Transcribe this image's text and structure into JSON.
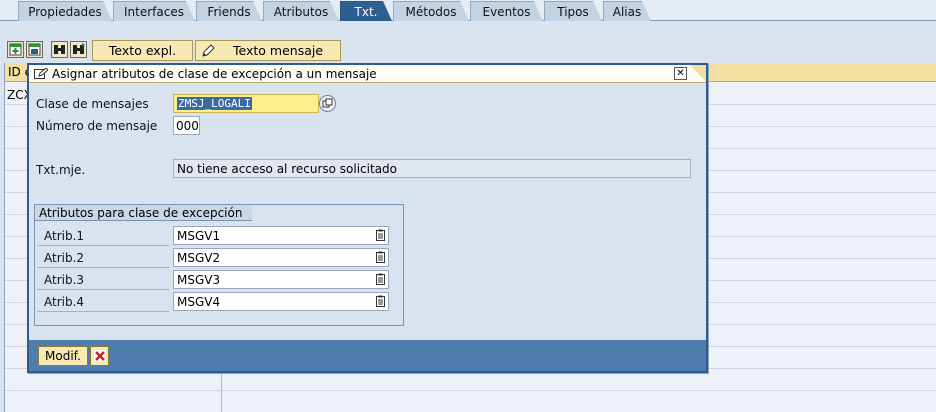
{
  "tabs": [
    {
      "label": "Propiedades",
      "active": false
    },
    {
      "label": "Interfaces",
      "active": false
    },
    {
      "label": "Friends",
      "active": false
    },
    {
      "label": "Atributos",
      "active": false
    },
    {
      "label": "Txt.",
      "active": true
    },
    {
      "label": "Métodos",
      "active": false
    },
    {
      "label": "Eventos",
      "active": false
    },
    {
      "label": "Tipos",
      "active": false
    },
    {
      "label": "Alias",
      "active": false
    }
  ],
  "toolbar": {
    "icons": [
      "insert-row-icon",
      "save-icon",
      "find-icon",
      "find-next-icon"
    ],
    "text_expl_label": "Texto expl.",
    "text_msg_label": "Texto mensaje",
    "text_msg_icon": "pencil-icon"
  },
  "grid": {
    "header_text": "ID e",
    "first_cell": "ZCX"
  },
  "dialog": {
    "title": "Asignar atributos de clase de excepción a un mensaje",
    "title_icon": "edit-document-icon",
    "close_icon": "close-icon",
    "msg_class_label": "Clase de mensajes",
    "msg_class_value": "ZMSJ_LOGALI",
    "msg_number_label": "Número de mensaje",
    "msg_number_value": "000",
    "msg_text_label": "Txt.mje.",
    "msg_text_value": "No tiene acceso al recurso solicitado",
    "group_title": "Atributos para clase de excepción",
    "attributes": [
      {
        "label": "Atrib.1",
        "value": "MSGV1"
      },
      {
        "label": "Atrib.2",
        "value": "MSGV2"
      },
      {
        "label": "Atrib.3",
        "value": "MSGV3"
      },
      {
        "label": "Atrib.4",
        "value": "MSGV4"
      }
    ],
    "modify_label": "Modif.",
    "cancel_icon": "cancel-x-icon"
  },
  "colors": {
    "active_tab": "#2f5f92",
    "footer_bar": "#4f7dad",
    "highlight_input": "#ffef8a",
    "button_bg": "#f6e9b3"
  }
}
